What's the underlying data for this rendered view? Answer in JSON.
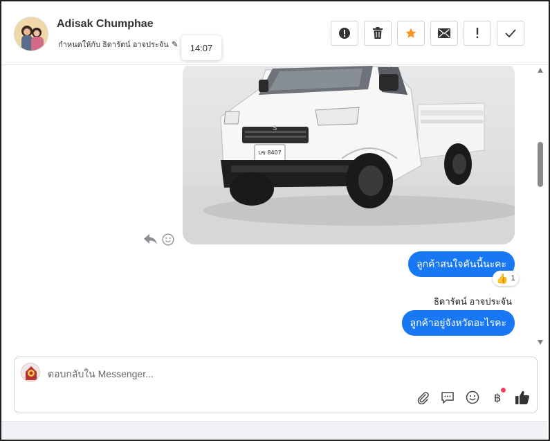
{
  "header": {
    "contact_name": "Adisak Chumphae",
    "assigned_to": "กำหนดให้กับ ธิดารัตน์ อาจประจัน",
    "tooltip_time": "14:07"
  },
  "actions": [
    {
      "name": "report-button",
      "icon": "alert-circle-icon"
    },
    {
      "name": "delete-button",
      "icon": "trash-icon"
    },
    {
      "name": "star-button",
      "icon": "star-icon",
      "color": "#f7941d"
    },
    {
      "name": "mark-unread-button",
      "icon": "envelope-icon"
    },
    {
      "name": "follow-up-button",
      "icon": "exclamation-icon"
    },
    {
      "name": "done-button",
      "icon": "check-icon"
    }
  ],
  "messages": {
    "photo_plate": "บข 8407",
    "bubble_1": "ลูกค้าสนใจคันนี้นะคะ",
    "reaction_count": "1",
    "sender_name": "ธิดารัตน์ อาจประจัน",
    "bubble_2": "ลูกค้าอยู่จังหวัดอะไรคะ"
  },
  "composer": {
    "placeholder": "ตอบกลับใน Messenger...",
    "value": ""
  },
  "colors": {
    "bubble": "#1877f2",
    "star": "#f7941d",
    "notification_dot": "#f3425f"
  }
}
